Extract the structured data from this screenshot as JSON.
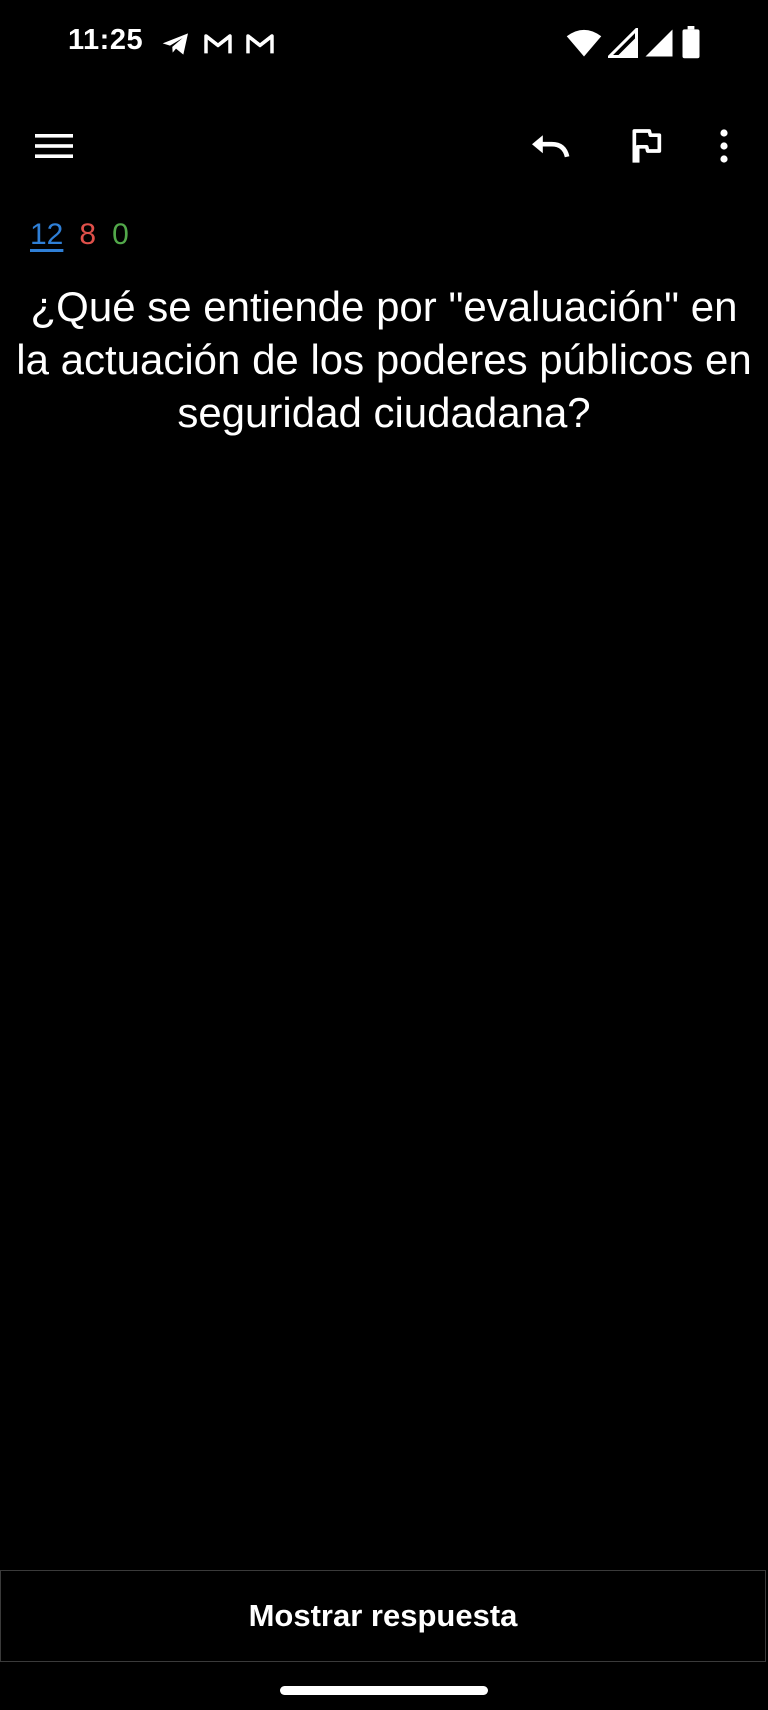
{
  "status_bar": {
    "time": "11:25",
    "notification_icons": [
      "telegram-icon",
      "gmail-icon",
      "gmail-icon"
    ],
    "system_icons": [
      "wifi-icon",
      "cell-signal-icon",
      "cell-signal-icon",
      "battery-icon"
    ]
  },
  "toolbar": {
    "menu_icon": "menu-icon",
    "undo_icon": "undo-icon",
    "flag_icon": "flag-icon",
    "more_icon": "more-vert-icon"
  },
  "counts": {
    "new": "12",
    "learning": "8",
    "review": "0",
    "colors": {
      "new": "#2f7fd6",
      "learning": "#e0504a",
      "review": "#52a84a"
    }
  },
  "card": {
    "question": "¿Qué se entiende por \"evaluación\" en la actuación de los poderes públicos en seguridad ciudadana?"
  },
  "bottom": {
    "show_answer_label": "Mostrar respuesta"
  },
  "theme": {
    "background": "#000000",
    "text": "#ffffff"
  }
}
